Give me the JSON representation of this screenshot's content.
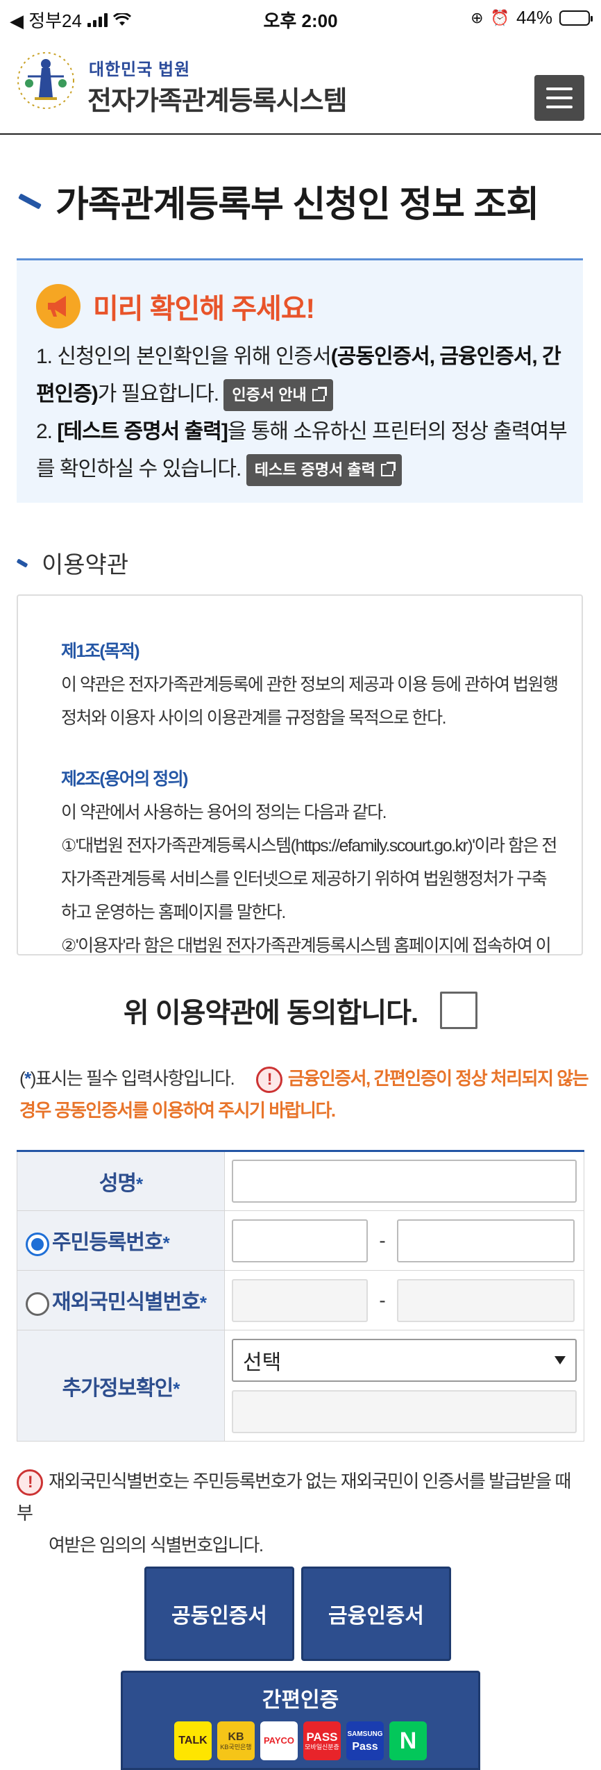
{
  "status_bar": {
    "carrier": "◀ 정부24",
    "time": "오후 2:00",
    "battery_text": "44%",
    "battery_level": 0.44
  },
  "header": {
    "logo_sub": "대한민국 법원",
    "logo_main": "전자가족관계등록시스템"
  },
  "page_title": "가족관계등록부 신청인 정보 조회",
  "notice": {
    "title": "미리 확인해 주세요!",
    "item1_a": "1. 신청인의 본인확인을 위해 인증서",
    "item1_b": "(공동인증서, 금융인증서, 간편인증)",
    "item1_c": "가 필요합니다.",
    "cert_guide_button": "인증서 안내",
    "item2_a": "2. ",
    "item2_b": "[테스트 증명서 출력]",
    "item2_c": "을 통해 소유하신 프린터의 정상 출력여부를 확인하실 수 있습니다.",
    "test_print_button": "테스트 증명서 출력"
  },
  "terms": {
    "section_title": "이용약관",
    "art1_title": "제1조(목적)",
    "art1_body": "이 약관은 전자가족관계등록에 관한 정보의 제공과 이용 등에 관하여 법원행정처와 이용자 사이의 이용관계를 규정함을 목적으로 한다.",
    "art2_title": "제2조(용어의 정의)",
    "art2_intro": "이 약관에서 사용하는 용어의 정의는 다음과 같다.",
    "art2_item1": "①'대법원 전자가족관계등록시스템(https://efamily.scourt.go.kr)'이라 함은 전자가족관계등록 서비스를 인터넷으로 제공하기 위하여 법원행정처가 구축하고 운영하는 홈페이지를 말한다.",
    "art2_item2": "②'이용자'라 함은 대법원 전자가족관계등록시스템 홈페이지에 접속하여 이"
  },
  "agree_label": "위 이용약관에 동의합니다.",
  "required_note": {
    "prefix": "(",
    "star": "*",
    "suffix": ")표시는 필수 입력사항입니다.",
    "warning": "금융인증서, 간편인증이 정상 처리되지 않는 경우 공동인증서를 이용하여 주시기 바랍니다."
  },
  "form": {
    "name_label": "성명",
    "rrn_label": "주민등록번호",
    "foreign_label": "재외국민식별번호",
    "extra_label": "추가정보확인",
    "required_mark": "*",
    "dash": "-",
    "select_value": "선택"
  },
  "foreign_note": {
    "line1": "재외국민식별번호는 주민등록번호가 없는 재외국민이 인증서를 발급받을 때 부",
    "line2": "여받은 임의의 식별번호입니다."
  },
  "buttons": {
    "joint_cert": "공동인증서",
    "financial_cert": "금융인증서",
    "simple_auth": "간편인증"
  },
  "simple_providers": {
    "kakao": "TALK",
    "kb": "KB",
    "kb_sub": "KB국민은행",
    "payco": "PAYCO",
    "pass": "PASS",
    "pass_sub": "모바일신분증",
    "samsung_top": "SAMSUNG",
    "samsung": "Pass",
    "naver": "N"
  },
  "colors": {
    "primary": "#2d4e8e",
    "accent_orange": "#e8742a",
    "notice_bg": "#eef5fd",
    "title_red": "#e8542a"
  }
}
